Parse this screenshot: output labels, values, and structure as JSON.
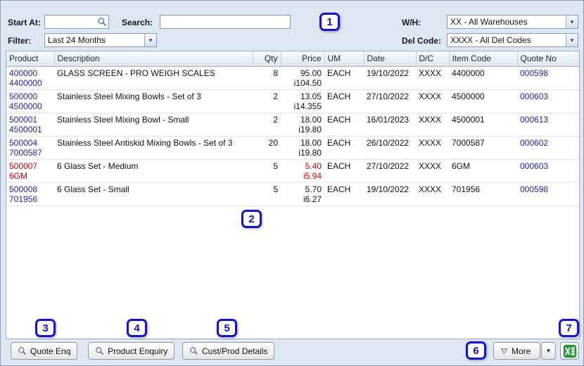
{
  "toolbar": {
    "start_at": {
      "label": "Start At:",
      "value": ""
    },
    "search": {
      "label": "Search:",
      "value": ""
    },
    "filter": {
      "label": "Filter:",
      "value": "Last 24 Months"
    },
    "warehouse": {
      "label": "W/H:",
      "value": "XX - All Warehouses"
    },
    "del_code": {
      "label": "Del Code:",
      "value": "XXXX - All Del Codes"
    }
  },
  "table": {
    "columns": [
      "Product",
      "Description",
      "Qty",
      "Price",
      "UM",
      "Date",
      "D/C",
      "Item Code",
      "Quote No"
    ],
    "rows": [
      {
        "product1": "400000",
        "product2": "4400000",
        "description": "GLASS SCREEN - PRO WEIGH SCALES",
        "qty": "8",
        "price1": "95.00",
        "price2": "i104.50",
        "um": "EACH",
        "date": "19/10/2022",
        "dc": "XXXX",
        "item_code": "4400000",
        "quote_no": "000598"
      },
      {
        "product1": "500000",
        "product2": "4500000",
        "description": "Stainless Steel Mixing Bowls - Set of 3",
        "qty": "2",
        "price1": "13.05",
        "price2": "i14.355",
        "um": "EACH",
        "date": "27/10/2022",
        "dc": "XXXX",
        "item_code": "4500000",
        "quote_no": "000603"
      },
      {
        "product1": "500001",
        "product2": "4500001",
        "description": "Stainless Steel Mixing Bowl - Small",
        "qty": "2",
        "price1": "18.00",
        "price2": "i19.80",
        "um": "EACH",
        "date": "16/01/2023",
        "dc": "XXXX",
        "item_code": "4500001",
        "quote_no": "000613"
      },
      {
        "product1": "500004",
        "product2": "7000587",
        "description": "Stainless Steel Antiskid Mixing Bowls - Set of 3",
        "qty": "20",
        "price1": "18.00",
        "price2": "i19.80",
        "um": "EACH",
        "date": "26/10/2022",
        "dc": "XXXX",
        "item_code": "7000587",
        "quote_no": "000602"
      },
      {
        "product1": "500007",
        "product2": "6GM",
        "description": "6 Glass Set - Medium",
        "qty": "5",
        "price1": "5.40",
        "price2": "i5.94",
        "um": "EACH",
        "date": "27/10/2022",
        "dc": "XXXX",
        "item_code": "6GM",
        "quote_no": "000603"
      },
      {
        "product1": "500008",
        "product2": "701956",
        "description": "6 Glass Set - Small",
        "qty": "5",
        "price1": "5.70",
        "price2": "i6.27",
        "um": "EACH",
        "date": "19/10/2022",
        "dc": "XXXX",
        "item_code": "701956",
        "quote_no": "000598"
      }
    ]
  },
  "footer": {
    "quote_enq_label": "Quote Enq",
    "product_enquiry_label": "Product Enquiry",
    "cust_prod_details_label": "Cust/Prod Details",
    "more_label": "More"
  },
  "annotations": [
    "1",
    "2",
    "3",
    "4",
    "5",
    "6",
    "7"
  ],
  "icons": {
    "start_at_field": "magnifier-icon",
    "footer_enquiry_buttons": "magnifier-icon",
    "more_button": "triangle-down-icon",
    "more_split_button": "caret-down-icon",
    "export_button": "excel-icon",
    "combos": "chevron-down-icon"
  },
  "colors": {
    "link_blue": "#2222b2",
    "alert_red": "#d80000",
    "annotation_blue": "#1414c8",
    "panel_bg": "#dde8f2"
  }
}
